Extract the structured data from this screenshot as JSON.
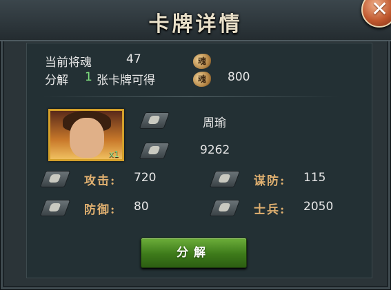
{
  "dialog": {
    "title": "卡牌详情",
    "close_label": "✕"
  },
  "soul": {
    "current_label": "当前将魂",
    "current_value": "47",
    "decompose_prefix": "分解",
    "decompose_count": "1",
    "decompose_suffix": "张卡牌可得",
    "reward_value": "800",
    "icon_glyph": "魂"
  },
  "card": {
    "name": "周瑜",
    "count_badge": "x1",
    "power": "9262"
  },
  "stats": {
    "attack_label": "攻击:",
    "attack_value": "720",
    "strategy_def_label": "谋防:",
    "strategy_def_value": "115",
    "defense_label": "防御:",
    "defense_value": "80",
    "soldiers_label": "士兵:",
    "soldiers_value": "2050"
  },
  "actions": {
    "decompose_button": "分解"
  },
  "colors": {
    "highlight": "#7fe07f",
    "stat_label": "#e0b070",
    "button_green": "#3d7a1a"
  }
}
